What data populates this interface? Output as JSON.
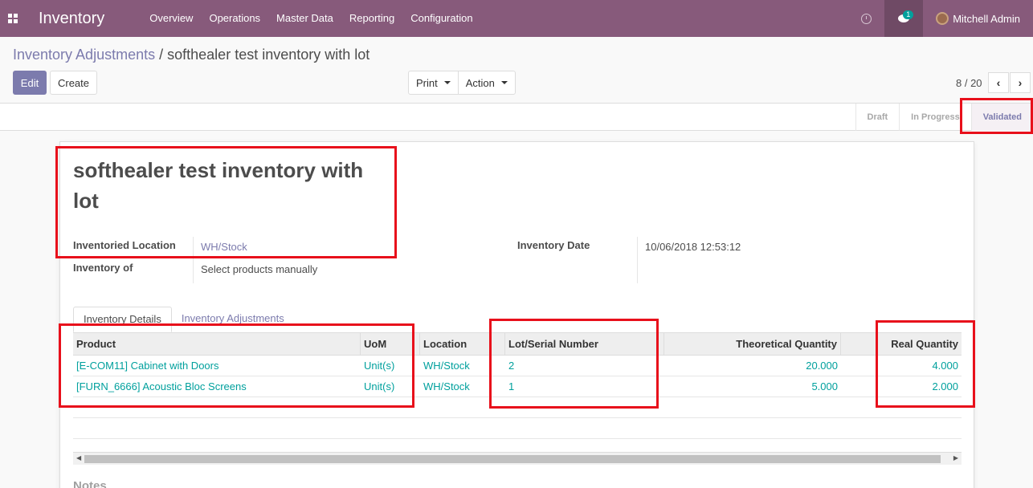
{
  "navbar": {
    "brand": "Inventory",
    "menu": [
      "Overview",
      "Operations",
      "Master Data",
      "Reporting",
      "Configuration"
    ],
    "chat_badge": "1",
    "user_name": "Mitchell Admin"
  },
  "breadcrumb": {
    "parent": "Inventory Adjustments",
    "separator": "/",
    "current": "softhealer test inventory with lot"
  },
  "buttons": {
    "edit": "Edit",
    "create": "Create",
    "print": "Print",
    "action": "Action"
  },
  "pager": {
    "value": "8 / 20",
    "prev": "‹",
    "next": "›"
  },
  "statusbar": {
    "stages": [
      "Draft",
      "In Progress",
      "Validated"
    ],
    "active": "Validated"
  },
  "form": {
    "title": "softhealer test inventory with lot",
    "inventoried_location_label": "Inventoried Location",
    "inventoried_location_value": "WH/Stock",
    "inventory_of_label": "Inventory of",
    "inventory_of_value": "Select products manually",
    "inventory_date_label": "Inventory Date",
    "inventory_date_value": "10/06/2018 12:53:12"
  },
  "tabs": [
    "Inventory Details",
    "Inventory Adjustments"
  ],
  "table": {
    "headers": [
      "Product",
      "UoM",
      "Location",
      "Lot/Serial Number",
      "Theoretical Quantity",
      "Real Quantity"
    ],
    "rows": [
      [
        "[E-COM11] Cabinet with Doors",
        "Unit(s)",
        "WH/Stock",
        "2",
        "20.000",
        "4.000"
      ],
      [
        "[FURN_6666] Acoustic Bloc Screens",
        "Unit(s)",
        "WH/Stock",
        "1",
        "5.000",
        "2.000"
      ]
    ]
  },
  "notes_label": "Notes",
  "colors": {
    "navbar": "#875a7b",
    "link": "#7c7bad",
    "teal": "#00a09d",
    "annotation": "#e8101b"
  }
}
